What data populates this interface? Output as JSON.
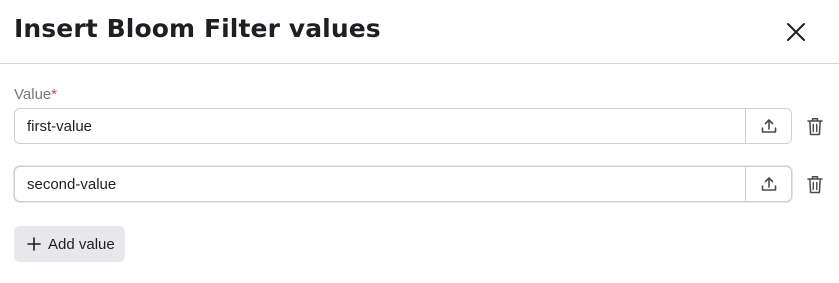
{
  "dialog": {
    "title": "Insert Bloom Filter values",
    "close_icon": "close-icon"
  },
  "form": {
    "field_label": "Value",
    "required_marker": "*",
    "values": [
      {
        "value": "first-value",
        "upload_icon": "upload-icon",
        "delete_icon": "trash-icon"
      },
      {
        "value": "second-value",
        "upload_icon": "upload-icon",
        "delete_icon": "trash-icon"
      }
    ],
    "add_button_label": "Add value",
    "add_icon": "plus-icon"
  },
  "colors": {
    "text": "#1f1f23",
    "muted_label": "#77777f",
    "required": "#d6424d",
    "border": "#cfcfd6",
    "add_button_bg": "#e7e7ec"
  }
}
